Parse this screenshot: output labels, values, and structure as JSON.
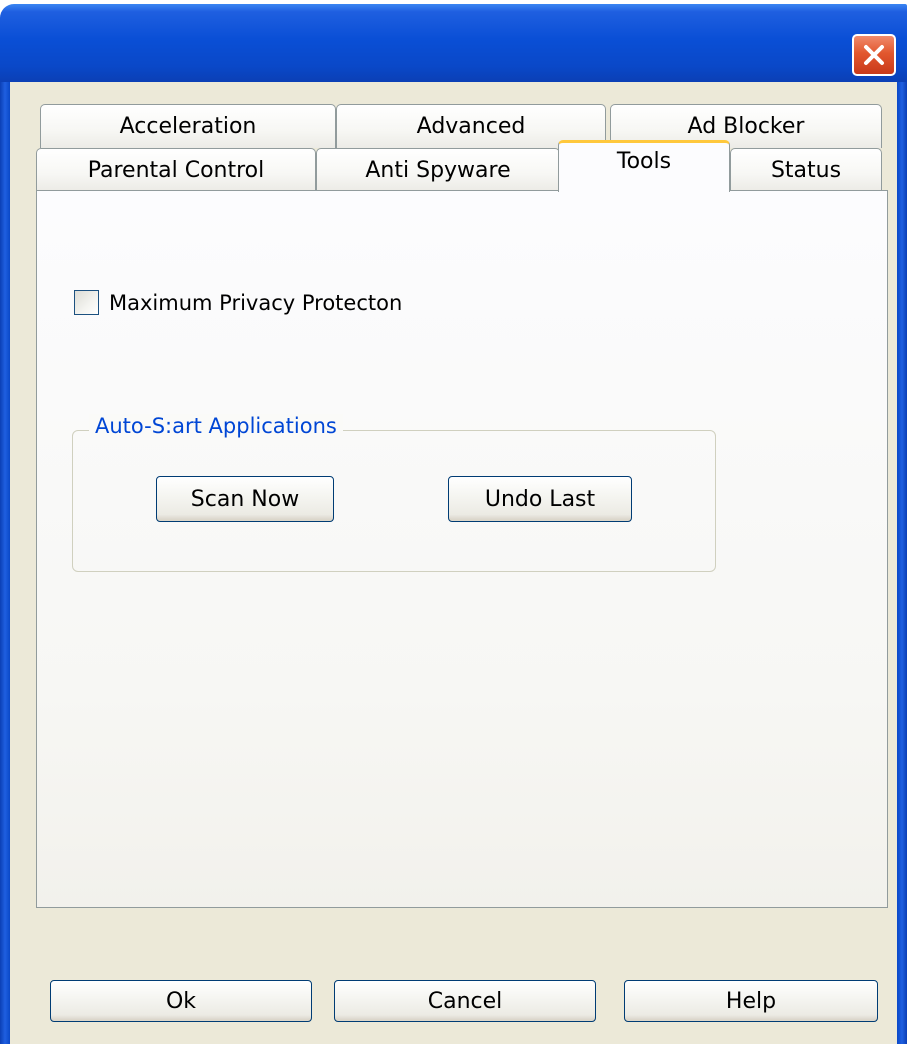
{
  "window": {
    "close_label": "close"
  },
  "tabs": {
    "row1": [
      {
        "label": "Acceleration"
      },
      {
        "label": "Advanced"
      },
      {
        "label": "Ad Blocker"
      }
    ],
    "row2": [
      {
        "label": "Parental Control"
      },
      {
        "label": "Anti Spyware"
      },
      {
        "label": "Tools",
        "active": true
      },
      {
        "label": "Status"
      }
    ]
  },
  "tools": {
    "privacy_checkbox": {
      "label": "Maximum Privacy Protecton",
      "checked": false
    },
    "group": {
      "legend": "Auto-S:art Applications",
      "scan_label": "Scan Now",
      "undo_label": "Undo Last"
    }
  },
  "footer": {
    "ok_label": "Ok",
    "cancel_label": "Cancel",
    "help_label": "Help"
  },
  "colors": {
    "titlebar": "#0a4fd6",
    "dialog_bg": "#ece9d8",
    "group_legend": "#0046d5",
    "active_tab_accent": "#ffc83c",
    "close_button": "#e2572e"
  },
  "icons": {
    "close": "close-icon"
  }
}
